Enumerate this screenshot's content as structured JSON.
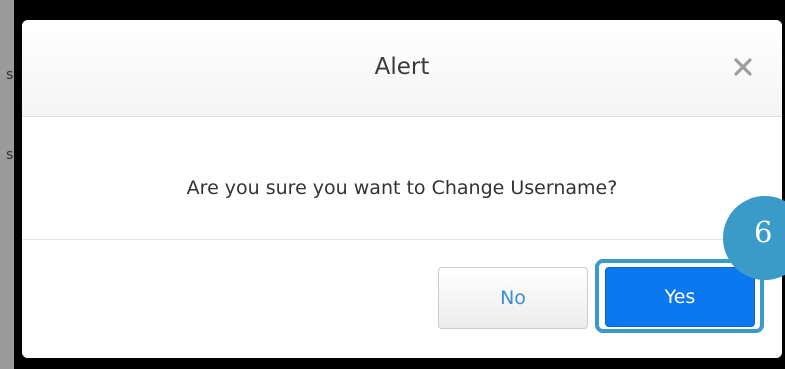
{
  "backdrop": {
    "glyph_top": "s",
    "glyph_bottom": "s"
  },
  "alert": {
    "title": "Alert",
    "close_icon": "close-icon",
    "message": "Are you sure you want to Change Username?",
    "no_label": "No",
    "yes_label": "Yes"
  },
  "annotation": {
    "step_number": "6"
  },
  "colors": {
    "primary_button": "#0b78f0",
    "secondary_button_text": "#3b8fd6",
    "highlight": "#3a9bc9",
    "backdrop": "#000000"
  }
}
